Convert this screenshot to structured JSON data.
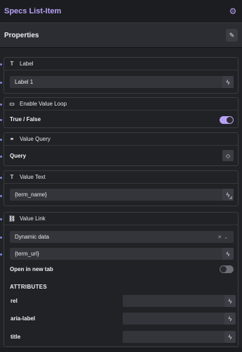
{
  "header": {
    "title": "Specs List-Item",
    "settings_icon": "gear-icon"
  },
  "properties": {
    "title": "Properties",
    "edit_icon": "pencil-icon"
  },
  "label_group": {
    "title": "Label",
    "icon": "text-type-icon",
    "value": "Label 1"
  },
  "loop_group": {
    "title": "Enable Value Loop",
    "icon": "loop-toggle-icon",
    "row_label": "True / False",
    "toggle_on": true
  },
  "query_group": {
    "title": "Value Query",
    "icon": "link-chain-icon",
    "row_label": "Query"
  },
  "text_group": {
    "title": "Value Text",
    "icon": "text-type-icon",
    "value": "{term_name}"
  },
  "link_group": {
    "title": "Value Link",
    "icon": "link-icon",
    "select_value": "Dynamic data",
    "url_value": "{term_url}",
    "new_tab_label": "Open in new tab",
    "new_tab_on": false,
    "attributes_heading": "ATTRIBUTES",
    "attributes": [
      {
        "label": "rel",
        "value": ""
      },
      {
        "label": "aria-label",
        "value": ""
      },
      {
        "label": "title",
        "value": ""
      }
    ]
  },
  "colors": {
    "accent": "#b7a1f7",
    "background": "#202226",
    "field": "#33353b"
  }
}
